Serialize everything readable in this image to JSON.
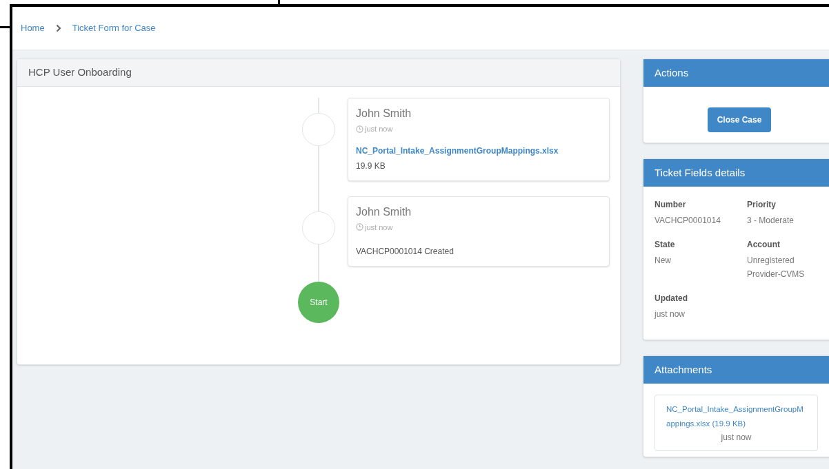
{
  "breadcrumb": [
    {
      "label": "Home"
    },
    {
      "label": "Ticket Form for Case"
    }
  ],
  "timeline": {
    "title": "HCP User Onboarding",
    "entries": [
      {
        "kind": "attachment",
        "author": "John Smith",
        "time": "just now",
        "file": "NC_Portal_Intake_AssignmentGroupMappings.xlsx",
        "size": "19.9 KB"
      },
      {
        "kind": "note",
        "author": "John Smith",
        "time": "just now",
        "text": "VACHCP0001014 Created"
      }
    ],
    "start": "Start"
  },
  "actions": {
    "title": "Actions",
    "button": "Close Case"
  },
  "details": {
    "title": "Ticket Fields details",
    "fields": [
      {
        "label": "Number",
        "value": "VACHCP0001014"
      },
      {
        "label": "Priority",
        "value": "3 - Moderate"
      },
      {
        "label": "State",
        "value": "New"
      },
      {
        "label": "Account",
        "value": "Unregistered Provider-CVMS"
      },
      {
        "label": "Updated",
        "value": "just now"
      }
    ]
  },
  "attachments": {
    "title": "Attachments",
    "items": [
      {
        "file": "NC_Portal_Intake_AssignmentGroupMappings.xlsx (19.9 KB)",
        "time": "just now"
      }
    ]
  }
}
